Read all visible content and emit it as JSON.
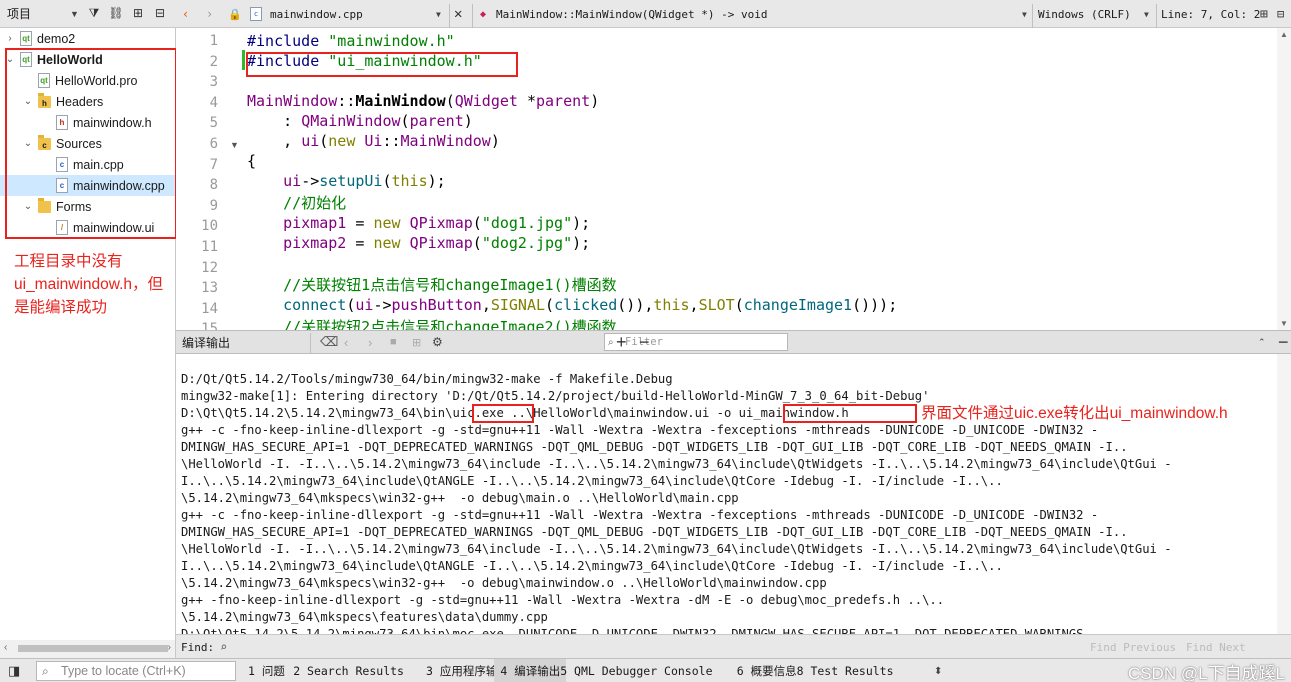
{
  "project_panel": {
    "title": "项目",
    "tree": [
      {
        "label": "demo2",
        "level": 0,
        "arrow": "›",
        "icon": "pro",
        "bold": false
      },
      {
        "label": "HelloWorld",
        "level": 0,
        "arrow": "⌄",
        "icon": "pro",
        "bold": true
      },
      {
        "label": "HelloWorld.pro",
        "level": 1,
        "arrow": "",
        "icon": "pro",
        "bold": false
      },
      {
        "label": "Headers",
        "level": 1,
        "arrow": "⌄",
        "icon": "folder-h",
        "bold": false
      },
      {
        "label": "mainwindow.h",
        "level": 2,
        "arrow": "",
        "icon": "hdr",
        "bold": false
      },
      {
        "label": "Sources",
        "level": 1,
        "arrow": "⌄",
        "icon": "folder-c",
        "bold": false
      },
      {
        "label": "main.cpp",
        "level": 2,
        "arrow": "",
        "icon": "doc",
        "bold": false
      },
      {
        "label": "mainwindow.cpp",
        "level": 2,
        "arrow": "",
        "icon": "doc",
        "bold": false,
        "selected": true
      },
      {
        "label": "Forms",
        "level": 1,
        "arrow": "⌄",
        "icon": "folder-ui",
        "bold": false
      },
      {
        "label": "mainwindow.ui",
        "level": 2,
        "arrow": "",
        "icon": "ui",
        "bold": false
      }
    ],
    "annotation": "工程目录中没有ui_mainwindow.h，但是能编译成功"
  },
  "editor_toolbar": {
    "file_name": "mainwindow.cpp",
    "symbol": "MainWindow::MainWindow(QWidget *) -> void",
    "line_ending": "Windows (CRLF)",
    "cursor": "Line: 7, Col: 2"
  },
  "editor": {
    "line_numbers": [
      "1",
      "2",
      "3",
      "4",
      "5",
      "6",
      "7",
      "8",
      "9",
      "10",
      "11",
      "12",
      "13",
      "14",
      "15"
    ]
  },
  "output_panel": {
    "title": "编译输出",
    "filter_placeholder": "Filter",
    "lines": [
      "D:/Qt/Qt5.14.2/Tools/mingw730_64/bin/mingw32-make -f Makefile.Debug",
      "mingw32-make[1]: Entering directory 'D:/Qt/Qt5.14.2/project/build-HelloWorld-MinGW_7_3_0_64_bit-Debug'",
      "D:\\Qt\\Qt5.14.2\\5.14.2\\mingw73_64\\bin\\uic.exe ..\\HelloWorld\\mainwindow.ui -o ui_mainwindow.h",
      "g++ -c -fno-keep-inline-dllexport -g -std=gnu++11 -Wall -Wextra -Wextra -fexceptions -mthreads -DUNICODE -D_UNICODE -DWIN32 -",
      "DMINGW_HAS_SECURE_API=1 -DQT_DEPRECATED_WARNINGS -DQT_QML_DEBUG -DQT_WIDGETS_LIB -DQT_GUI_LIB -DQT_CORE_LIB -DQT_NEEDS_QMAIN -I..",
      "\\HelloWorld -I. -I..\\..\\5.14.2\\mingw73_64\\include -I..\\..\\5.14.2\\mingw73_64\\include\\QtWidgets -I..\\..\\5.14.2\\mingw73_64\\include\\QtGui -",
      "I..\\..\\5.14.2\\mingw73_64\\include\\QtANGLE -I..\\..\\5.14.2\\mingw73_64\\include\\QtCore -Idebug -I. -I/include -I..\\..",
      "\\5.14.2\\mingw73_64\\mkspecs\\win32-g++  -o debug\\main.o ..\\HelloWorld\\main.cpp",
      "g++ -c -fno-keep-inline-dllexport -g -std=gnu++11 -Wall -Wextra -Wextra -fexceptions -mthreads -DUNICODE -D_UNICODE -DWIN32 -",
      "DMINGW_HAS_SECURE_API=1 -DQT_DEPRECATED_WARNINGS -DQT_QML_DEBUG -DQT_WIDGETS_LIB -DQT_GUI_LIB -DQT_CORE_LIB -DQT_NEEDS_QMAIN -I..",
      "\\HelloWorld -I. -I..\\..\\5.14.2\\mingw73_64\\include -I..\\..\\5.14.2\\mingw73_64\\include\\QtWidgets -I..\\..\\5.14.2\\mingw73_64\\include\\QtGui -",
      "I..\\..\\5.14.2\\mingw73_64\\include\\QtANGLE -I..\\..\\5.14.2\\mingw73_64\\include\\QtCore -Idebug -I. -I/include -I..\\..",
      "\\5.14.2\\mingw73_64\\mkspecs\\win32-g++  -o debug\\mainwindow.o ..\\HelloWorld\\mainwindow.cpp",
      "g++ -fno-keep-inline-dllexport -g -std=gnu++11 -Wall -Wextra -Wextra -dM -E -o debug\\moc_predefs.h ..\\..",
      "\\5.14.2\\mingw73_64\\mkspecs\\features\\data\\dummy.cpp",
      "D:\\Qt\\Qt5.14.2\\5.14.2\\mingw73_64\\bin\\moc.exe -DUNICODE -D_UNICODE -DWIN32 -DMINGW_HAS_SECURE_API=1 -DQT_DEPRECATED_WARNINGS"
    ],
    "annotation": "界面文件通过uic.exe转化出ui_mainwindow.h"
  },
  "find_bar": {
    "label": "Find:",
    "find_previous": "Find Previous",
    "find_next": "Find Next"
  },
  "status_bar": {
    "locate_placeholder": "Type to locate (Ctrl+K)",
    "tabs": [
      {
        "label": "1 问题",
        "active": false
      },
      {
        "label": "2 Search Results",
        "active": false
      },
      {
        "label": "3 应用程序输出",
        "active": false
      },
      {
        "label": "4 编译输出",
        "active": true
      },
      {
        "label": "5 QML Debugger Console",
        "active": false
      },
      {
        "label": "6 概要信息",
        "active": false
      },
      {
        "label": "8 Test Results",
        "active": false
      }
    ],
    "watermark": "CSDN @L下自成蹊L"
  }
}
